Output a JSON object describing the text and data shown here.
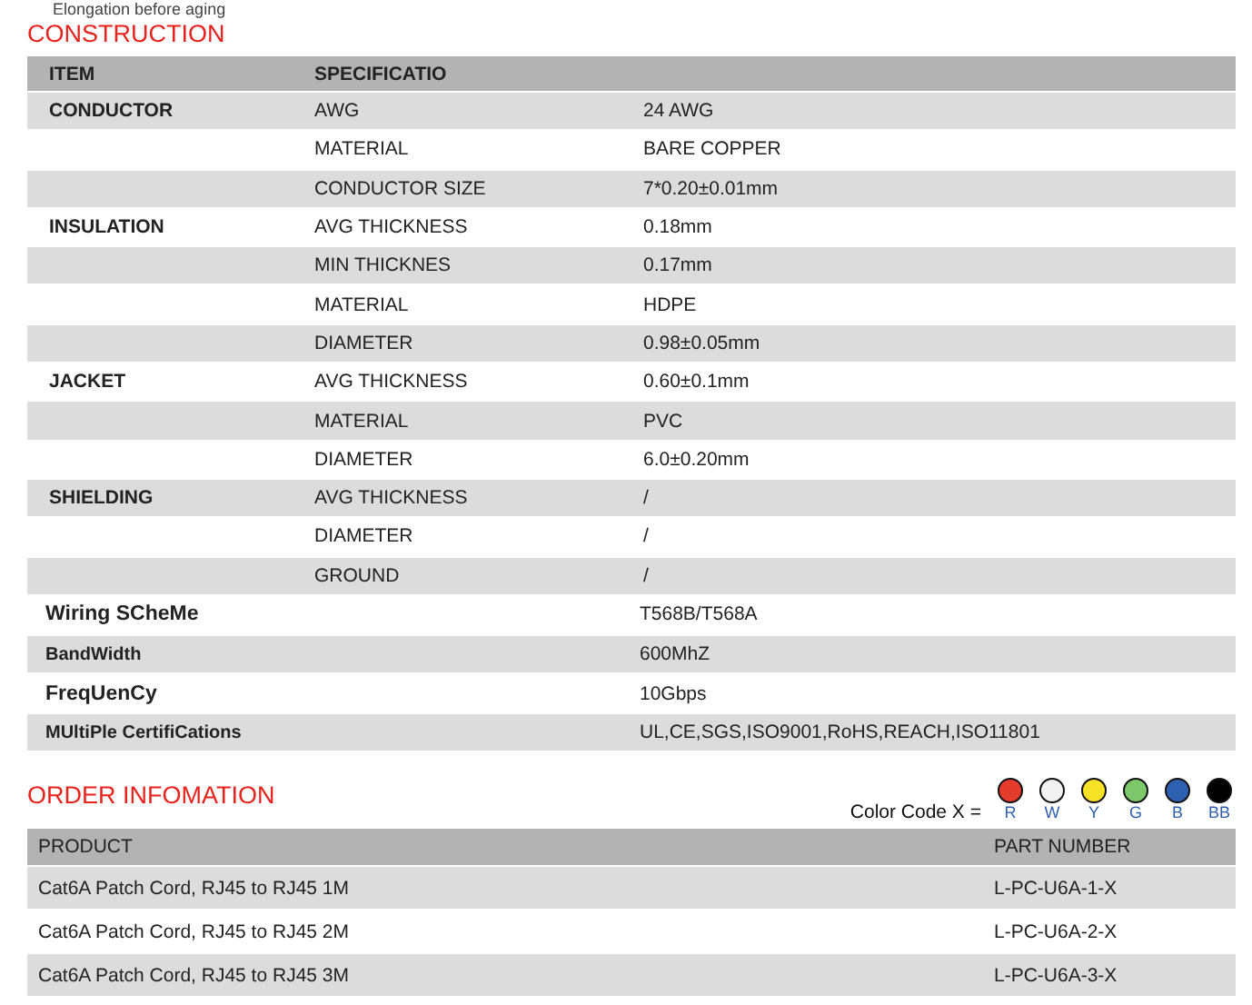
{
  "top_note": "Elongation before aging",
  "construction": {
    "title": "CONSTRUCTION",
    "columns": [
      "ITEM",
      "SPECIFICATIO"
    ],
    "rows": [
      {
        "item": "CONDUCTOR",
        "spec": "AWG",
        "value": "24 AWG"
      },
      {
        "spec": "MATERIAL",
        "value": "BARE COPPER"
      },
      {
        "spec": "CONDUCTOR SIZE",
        "value": "7*0.20±0.01mm"
      },
      {
        "item": "INSULATION",
        "spec": "AVG THICKNESS",
        "value": "0.18mm"
      },
      {
        "spec": "MIN THICKNES",
        "value": "0.17mm"
      },
      {
        "spec": "MATERIAL",
        "value": "HDPE"
      },
      {
        "spec": "DIAMETER",
        "value": "0.98±0.05mm"
      },
      {
        "item": "JACKET",
        "spec": "AVG THICKNESS",
        "value": "0.60±0.1mm"
      },
      {
        "spec": "MATERIAL",
        "value": "PVC"
      },
      {
        "spec": "DIAMETER",
        "value": "6.0±0.20mm"
      },
      {
        "item": "SHIELDING",
        "spec": "AVG THICKNESS",
        "value": "/"
      },
      {
        "spec": "DIAMETER",
        "value": "/"
      },
      {
        "spec": "GROUND",
        "value": "/"
      }
    ],
    "features": [
      {
        "label": "Wiring SCheMe",
        "value": "T568B/T568A"
      },
      {
        "label": "BandWidth",
        "value": "600MhZ"
      },
      {
        "label": "FreqUenCy",
        "value": "10Gbps"
      },
      {
        "label": "MUltiPle CertifiCations",
        "value": "UL,CE,SGS,ISO9001,RoHS,REACH,ISO11801"
      }
    ]
  },
  "order": {
    "title": "ORDER INFOMATION",
    "color_code_label": "Color Code X =",
    "colors": [
      {
        "code": "R",
        "color": "#e53a2e"
      },
      {
        "code": "W",
        "color": "#f2f2f2"
      },
      {
        "code": "Y",
        "color": "#f7e225"
      },
      {
        "code": "G",
        "color": "#7dc86a"
      },
      {
        "code": "B",
        "color": "#2f5fb0"
      },
      {
        "code": "BB",
        "color": "#000000"
      }
    ],
    "columns": [
      "PRODUCT",
      "PART NUMBER"
    ],
    "rows": [
      {
        "product": "Cat6A Patch Cord, RJ45 to RJ45 1M",
        "part": "L-PC-U6A-1-X"
      },
      {
        "product": "Cat6A Patch Cord, RJ45 to RJ45 2M",
        "part": "L-PC-U6A-2-X"
      },
      {
        "product": "Cat6A Patch Cord, RJ45 to RJ45 3M",
        "part": "L-PC-U6A-3-X"
      }
    ]
  }
}
